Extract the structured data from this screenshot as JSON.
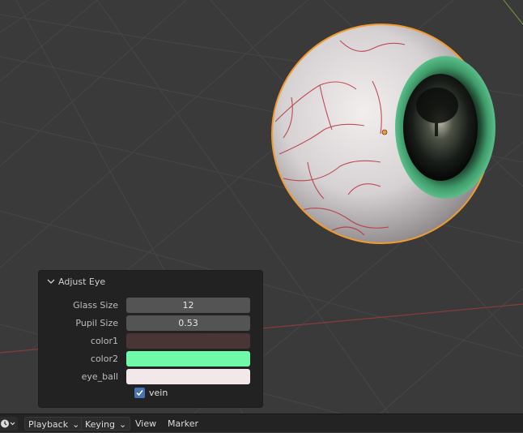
{
  "panel": {
    "title": "Adjust Eye",
    "glass_size": {
      "label": "Glass Size",
      "value": "12"
    },
    "pupil_size": {
      "label": "Pupil Size",
      "value": "0.53"
    },
    "color1": {
      "label": "color1",
      "color": "#4a3536"
    },
    "color2": {
      "label": "color2",
      "color": "#6efaa8"
    },
    "eye_ball": {
      "label": "eye_ball",
      "color": "#f3e8e8"
    },
    "vein": {
      "label": "vein",
      "checked": true
    }
  },
  "timeline": {
    "playback": "Playback",
    "keying": "Keying",
    "view": "View",
    "marker": "Marker"
  },
  "colors": {
    "viewport_bg": "#3a3a3a",
    "selection_outline": "#f29a2e",
    "iris": "#3f9a6a",
    "checkbox_accent": "#4772b3"
  }
}
